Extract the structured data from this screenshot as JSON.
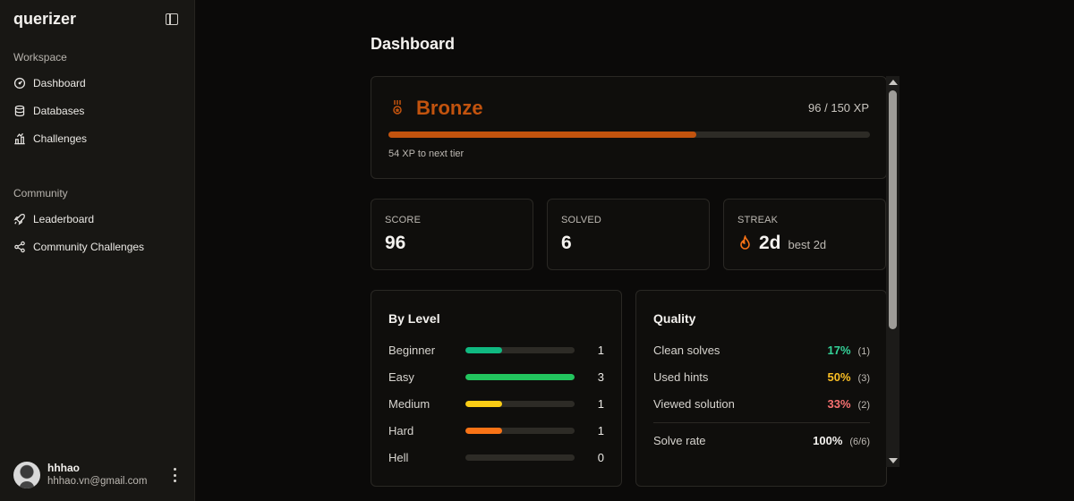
{
  "sidebar": {
    "brand": "querizer",
    "sections": [
      {
        "label": "Workspace"
      },
      {
        "label": "Community"
      }
    ],
    "items": [
      {
        "label": "Dashboard",
        "icon": "gauge-icon"
      },
      {
        "label": "Databases",
        "icon": "database-icon"
      },
      {
        "label": "Challenges",
        "icon": "challenges-icon"
      },
      {
        "label": "Leaderboard",
        "icon": "rocket-icon"
      },
      {
        "label": "Community Challenges",
        "icon": "share-icon"
      }
    ],
    "user": {
      "name": "hhhao",
      "email": "hhhao.vn@gmail.com"
    }
  },
  "main": {
    "title": "Dashboard",
    "tier": {
      "name": "Bronze",
      "xp_text": "96 / 150 XP",
      "xp_current": 96,
      "xp_max": 150,
      "next_text": "54 XP to next tier",
      "color": "#c2530e"
    },
    "stats": [
      {
        "label": "SCORE",
        "value": "96"
      },
      {
        "label": "SOLVED",
        "value": "6"
      },
      {
        "label": "STREAK",
        "value": "2d",
        "best": "best 2d"
      }
    ],
    "by_level": {
      "title": "By Level",
      "max": 3,
      "rows": [
        {
          "name": "Beginner",
          "count": 1,
          "count_text": "1",
          "color": "#10b981"
        },
        {
          "name": "Easy",
          "count": 3,
          "count_text": "3",
          "color": "#22c55e"
        },
        {
          "name": "Medium",
          "count": 1,
          "count_text": "1",
          "color": "#facc15"
        },
        {
          "name": "Hard",
          "count": 1,
          "count_text": "1",
          "color": "#f97316"
        },
        {
          "name": "Hell",
          "count": 0,
          "count_text": "0",
          "color": "#ef4444"
        }
      ]
    },
    "quality": {
      "title": "Quality",
      "rows": [
        {
          "name": "Clean solves",
          "pct": "17%",
          "count": "(1)",
          "color": "#34d399"
        },
        {
          "name": "Used hints",
          "pct": "50%",
          "count": "(3)",
          "color": "#fbbf24"
        },
        {
          "name": "Viewed solution",
          "pct": "33%",
          "count": "(2)",
          "color": "#f87171"
        }
      ],
      "solve_rate": {
        "name": "Solve rate",
        "pct": "100%",
        "count": "(6/6)",
        "color": "#f4f2ef"
      }
    }
  }
}
